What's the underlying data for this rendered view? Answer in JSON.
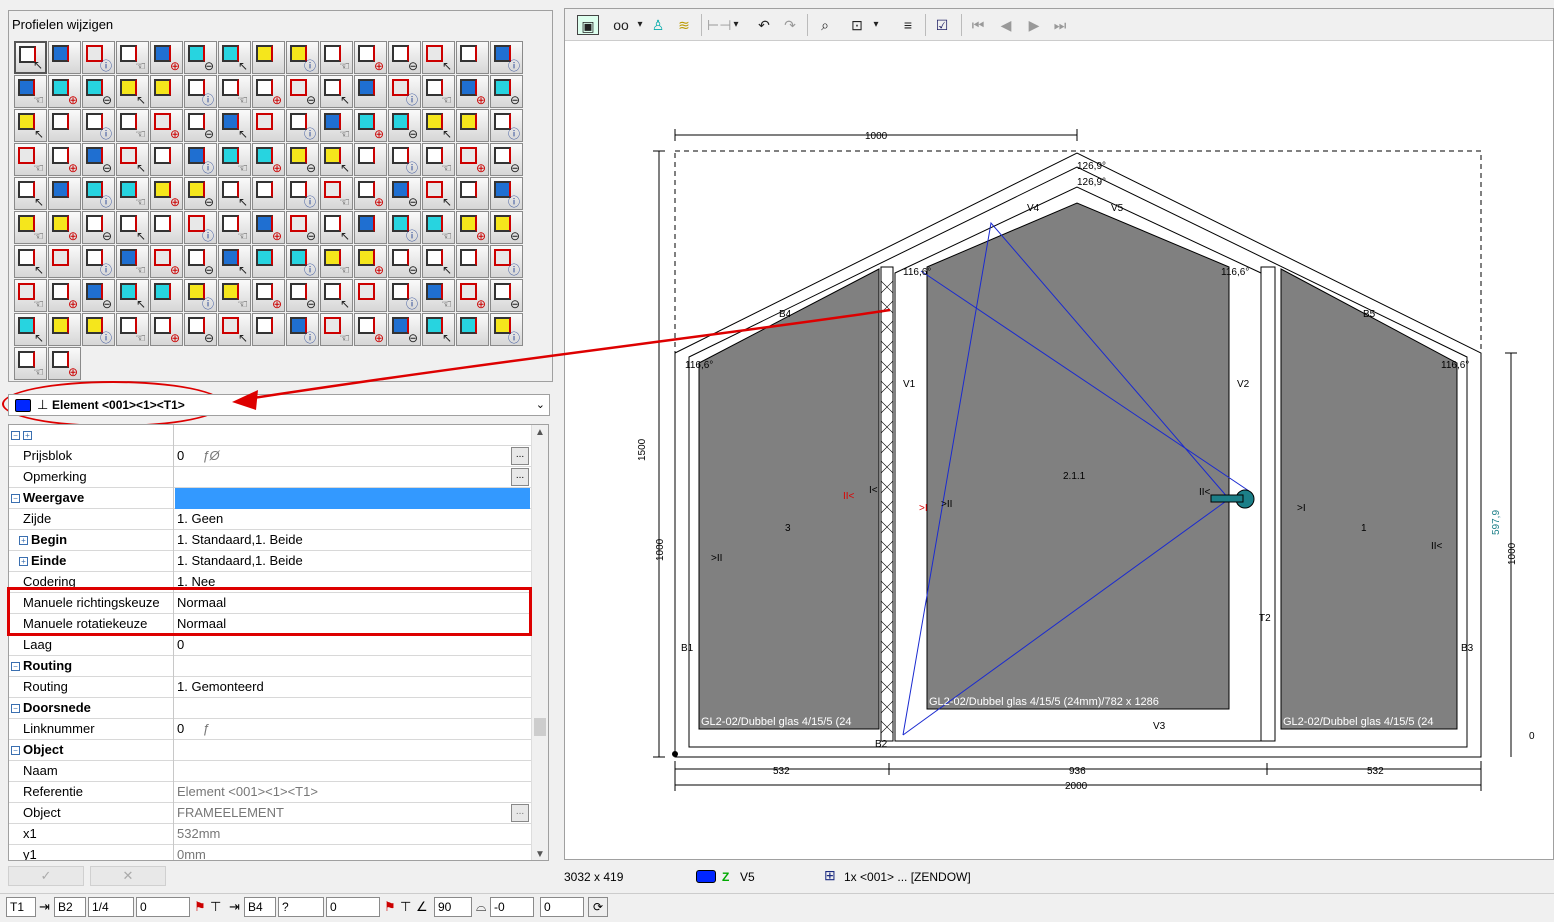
{
  "profiles_panel": {
    "title": "Profielen wijzigen"
  },
  "element_selector": {
    "label": "Element <001><1><T1>",
    "color": "#0026ff"
  },
  "properties": [
    {
      "name": "Prijsblok",
      "value": "0",
      "type": "row",
      "button": true,
      "extra": "ƒØ"
    },
    {
      "name": "Opmerking",
      "value": "",
      "type": "row",
      "button": true
    },
    {
      "name": "Weergave",
      "value": "",
      "type": "group",
      "highlight": true
    },
    {
      "name": "Zijde",
      "value": "1. Geen",
      "type": "row"
    },
    {
      "name": "Begin",
      "value": "1. Standaard,1. Beide",
      "type": "subgroup"
    },
    {
      "name": "Einde",
      "value": "1. Standaard,1. Beide",
      "type": "subgroup"
    },
    {
      "name": "Codering",
      "value": "1. Nee",
      "type": "row"
    },
    {
      "name": "Manuele richtingskeuze",
      "value": "Normaal",
      "type": "row"
    },
    {
      "name": "Manuele rotatiekeuze",
      "value": "Normaal",
      "type": "row"
    },
    {
      "name": "Laag",
      "value": "0",
      "type": "row"
    },
    {
      "name": "Routing",
      "value": "",
      "type": "group"
    },
    {
      "name": "Routing",
      "value": "1. Gemonteerd",
      "type": "row"
    },
    {
      "name": "Doorsnede",
      "value": "",
      "type": "group"
    },
    {
      "name": "Linknummer",
      "value": "0",
      "type": "row",
      "extra": "ƒ"
    },
    {
      "name": "Object",
      "value": "",
      "type": "group"
    },
    {
      "name": "Naam",
      "value": "",
      "type": "row"
    },
    {
      "name": "Referentie",
      "value": "Element <001><1><T1>",
      "type": "row",
      "gray": true
    },
    {
      "name": "Object",
      "value": "FRAMEELEMENT",
      "type": "row",
      "gray": true,
      "button": true
    },
    {
      "name": "x1",
      "value": "532mm",
      "type": "row",
      "gray": true
    },
    {
      "name": "y1",
      "value": "0mm",
      "type": "row",
      "gray": true
    }
  ],
  "ok_cancel": {
    "ok": "✓",
    "cancel": "✕"
  },
  "drawing": {
    "dims": {
      "top_left": "1000",
      "total_width": "2000",
      "left_width": "532",
      "middle_width": "936",
      "right_width": "532",
      "left_height": "1500",
      "left_lower_height": "1000",
      "right_height": "1000",
      "right_partial": "597,9",
      "level": "0"
    },
    "angles": {
      "a1": "126,9°",
      "a2": "126,9°",
      "b4": "116,6°",
      "v1": "116,6°",
      "v2": "116,6°",
      "b5": "116,6°"
    },
    "labels": {
      "B4": "B4",
      "V4": "V4",
      "V5": "V5",
      "B5": "B5",
      "V1": "V1",
      "V2": "V2",
      "B1": "B1",
      "B2": "B2",
      "B3": "B3",
      "V3": "V3",
      "T2": "T2",
      "sash_id": "2.1.1",
      "left_num": "3",
      "right_num": "1",
      "glass_left": "GL2-02/Dubbel glas 4/15/5 (24",
      "glass_mid": "GL2-02/Dubbel glas 4/15/5 (24mm)/782 x 1286",
      "glass_right": "GL2-02/Dubbel glas 4/15/5 (24"
    }
  },
  "status": {
    "dimensions": "3032 x 419",
    "profile": "V5",
    "object": "1x <001> ... [ZENDOW]"
  },
  "bottom": {
    "f1": "T1",
    "f2": "B2",
    "f3": "1/4",
    "f4": "0",
    "f5": "B4",
    "f6": "?",
    "f7": "0",
    "f8": "90",
    "f9": "-0",
    "f10": "0"
  }
}
